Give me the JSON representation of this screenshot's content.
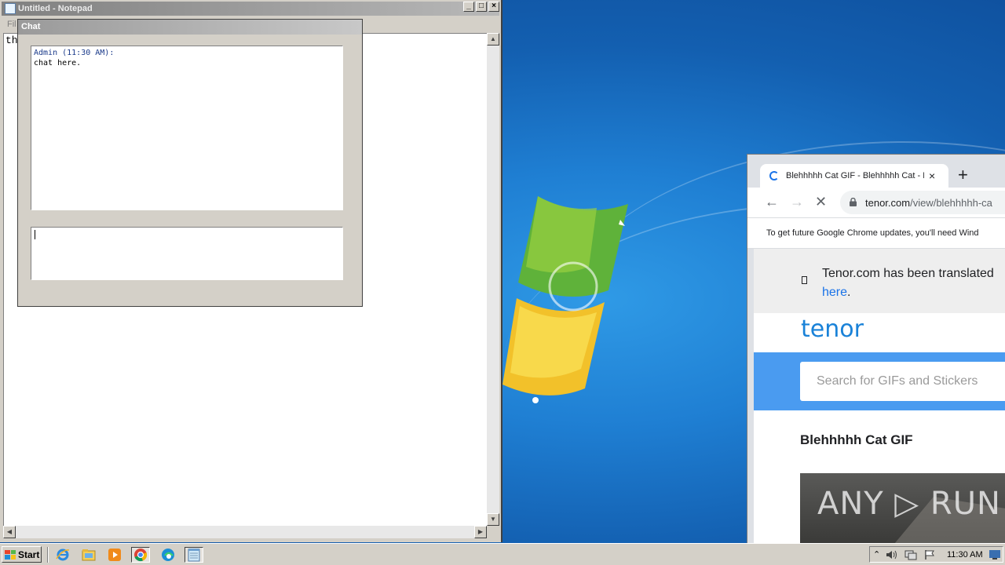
{
  "notepad": {
    "title": "Untitled - Notepad",
    "menu_first": "File",
    "menu_visible": "Fil",
    "content": "th",
    "min_label": "_",
    "max_label": "□",
    "close_label": "×"
  },
  "chat": {
    "title": "Chat",
    "messages": [
      {
        "sender": "Admin (11:30 AM):",
        "text": "chat here."
      }
    ],
    "input_value": ""
  },
  "chrome": {
    "tab_title": "Blehhhhh Cat GIF - Blehhhhh Cat - D",
    "tab_close": "×",
    "new_tab": "+",
    "url_host": "tenor.com",
    "url_path": "/view/blehhhhh-ca",
    "infobar_text": "To get future Google Chrome updates, you'll need Wind",
    "translate_text": "Tenor.com has been translated",
    "translate_link": "here",
    "translate_after": ".",
    "logo": "tenor",
    "search_placeholder": "Search for GIFs and Stickers",
    "gif_title": "Blehhhhh Cat GIF",
    "watermark": "ANY ▷ RUN"
  },
  "taskbar": {
    "start_label": "Start",
    "pinned": [
      "internet-explorer-icon",
      "explorer-folder-icon",
      "media-player-icon",
      "chrome-icon",
      "edge-icon",
      "notepad-icon"
    ],
    "active": "chrome-icon",
    "tray_chevron": "⌃",
    "clock": "11:30 AM"
  },
  "colors": {
    "desktop_blue": "#1f7fd3",
    "tenor_blue": "#4a9bf0",
    "link_blue": "#1a73e8"
  }
}
